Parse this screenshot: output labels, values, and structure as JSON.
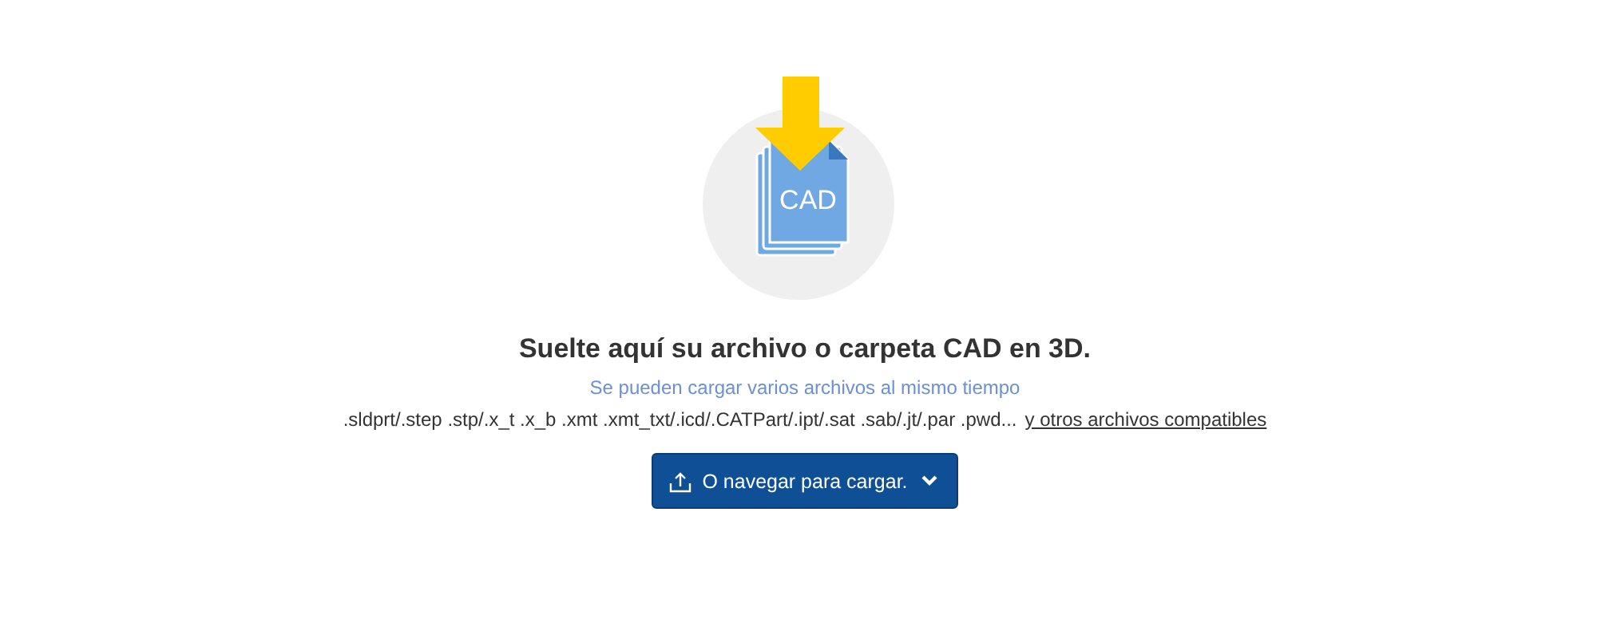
{
  "upload_icon": {
    "label": "CAD"
  },
  "title": "Suelte aquí su archivo o carpeta CAD en 3D.",
  "subtitle": "Se pueden cargar varios archivos al mismo tiempo",
  "formats": {
    "text": ".sldprt/.step .stp/.x_t .x_b .xmt .xmt_txt/.icd/.CATPart/.ipt/.sat .sab/.jt/.par .pwd...",
    "link": "y otros archivos compatibles"
  },
  "browse_button": {
    "label": "O navegar para cargar."
  }
}
